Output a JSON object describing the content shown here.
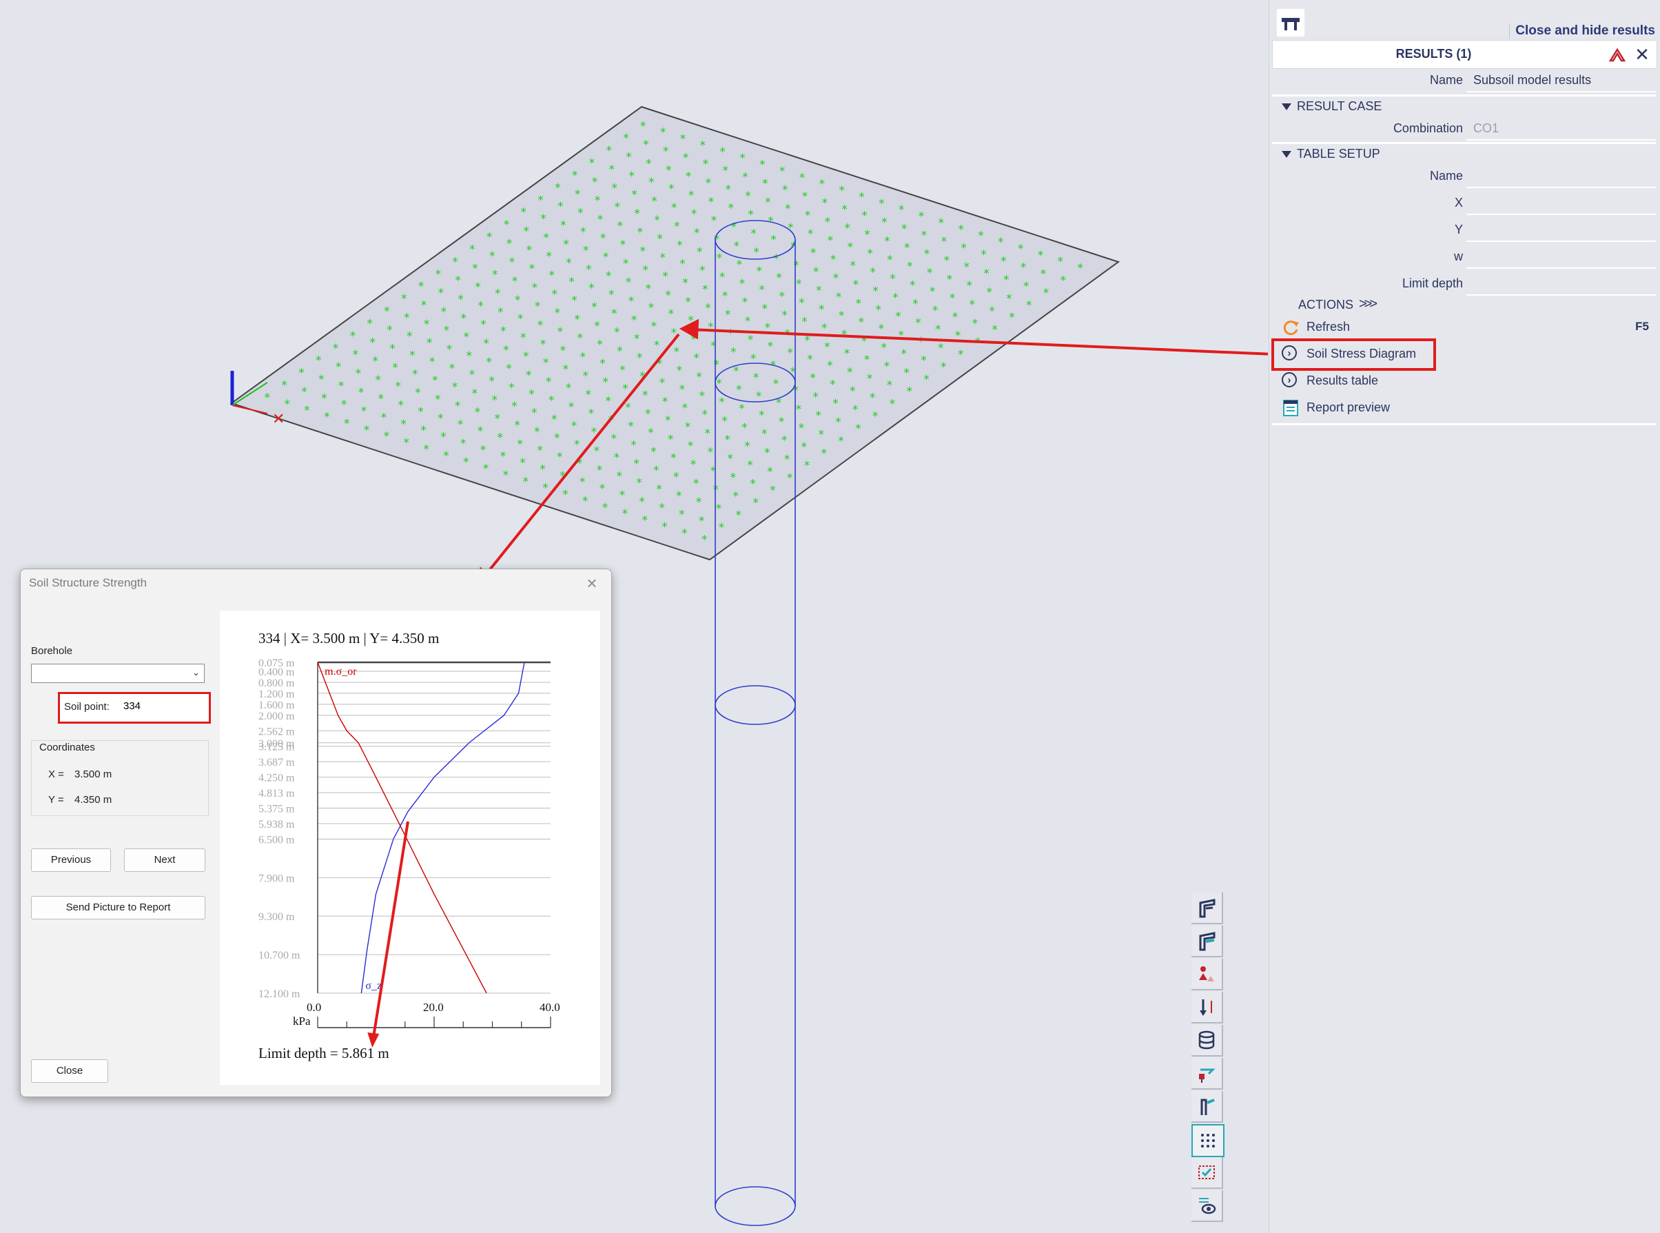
{
  "panel": {
    "close_hide": "Close and hide results",
    "results_title": "RESULTS (1)",
    "name_label": "Name",
    "name_value": "Subsoil model results",
    "result_case_section": "RESULT CASE",
    "combination_label": "Combination",
    "combination_value": "CO1",
    "table_setup_section": "TABLE SETUP",
    "table_setup_items": [
      {
        "label": "Name",
        "on": true
      },
      {
        "label": "X",
        "on": true
      },
      {
        "label": "Y",
        "on": true
      },
      {
        "label": "w",
        "on": true
      },
      {
        "label": "Limit depth",
        "on": true
      }
    ],
    "actions_title": "ACTIONS",
    "actions": [
      {
        "label": "Refresh",
        "key": "F5",
        "icon": "refresh-icon"
      },
      {
        "label": "Soil Stress Diagram",
        "key": "",
        "icon": "circle-chevron-icon"
      },
      {
        "label": "Results table",
        "key": "",
        "icon": "circle-chevron-icon"
      },
      {
        "label": "Report preview",
        "key": "",
        "icon": "report-icon"
      }
    ]
  },
  "dialog": {
    "title": "Soil Structure Strength",
    "borehole_label": "Borehole",
    "borehole_value": "",
    "soil_point_label": "Soil point:",
    "soil_point_value": "334",
    "coordinates_label": "Coordinates",
    "x_label": "X =",
    "x_value": "3.500 m",
    "y_label": "Y =",
    "y_value": "4.350 m",
    "previous_label": "Previous",
    "next_label": "Next",
    "send_label": "Send Picture to Report",
    "close_label": "Close"
  },
  "chart_data": {
    "type": "line",
    "title": "334 | X= 3.500 m | Y= 4.350 m",
    "xlabel": "kPa",
    "x_ticks": [
      "0.0",
      "20.0",
      "40.0"
    ],
    "xlim": [
      0,
      40
    ],
    "depth_labels": [
      "0.075 m",
      "0.400 m",
      "0.800 m",
      "1.200 m",
      "1.600 m",
      "2.000 m",
      "2.562 m",
      "3.000 m",
      "3.125 m",
      "3.687 m",
      "4.250 m",
      "4.813 m",
      "5.375 m",
      "5.938 m",
      "6.500 m",
      "7.900 m",
      "9.300 m",
      "10.700 m",
      "12.100 m"
    ],
    "depths": [
      0.075,
      0.4,
      0.8,
      1.2,
      1.6,
      2.0,
      2.562,
      3.0,
      3.125,
      3.687,
      4.25,
      4.813,
      5.375,
      5.938,
      6.5,
      7.9,
      9.3,
      10.7,
      12.1
    ],
    "series": [
      {
        "name": "m.σ_or",
        "color": "#cc0000",
        "points": [
          [
            0,
            0.075
          ],
          [
            3.5,
            2.0
          ],
          [
            5,
            2.562
          ],
          [
            7,
            3.0
          ],
          [
            10,
            4.25
          ],
          [
            14,
            5.938
          ],
          [
            20,
            8.5
          ],
          [
            29,
            12.1
          ]
        ]
      },
      {
        "name": "σ_z",
        "color": "#2a2ad6",
        "points": [
          [
            35.5,
            0.075
          ],
          [
            34.5,
            1.2
          ],
          [
            32,
            2.0
          ],
          [
            26,
            3.0
          ],
          [
            20,
            4.25
          ],
          [
            15.5,
            5.5
          ],
          [
            13,
            6.5
          ],
          [
            10,
            8.5
          ],
          [
            8.5,
            10.5
          ],
          [
            7.5,
            12.1
          ]
        ]
      }
    ],
    "footer": "Limit depth = 5.861 m"
  }
}
